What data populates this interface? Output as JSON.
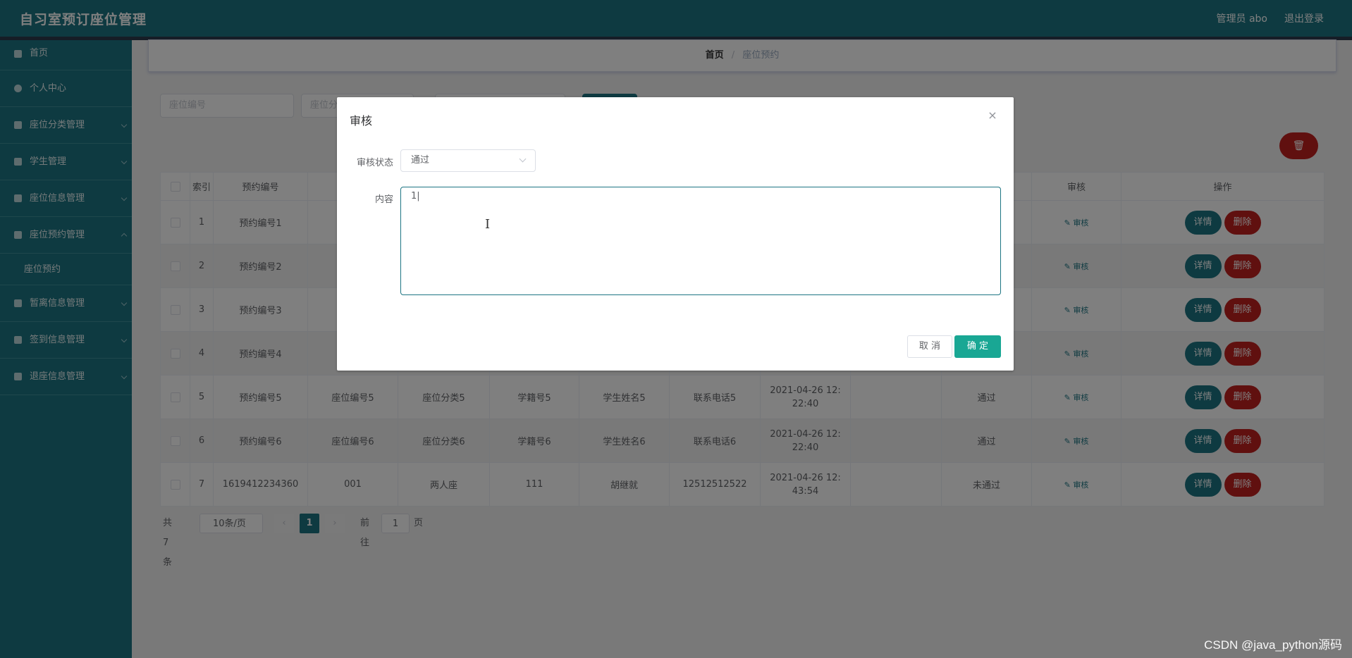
{
  "header": {
    "app_title": "自习室预订座位管理",
    "user": "管理员 abo",
    "logout": "退出登录"
  },
  "sidebar": {
    "items": [
      {
        "label": "首页",
        "icon": "home-icon"
      },
      {
        "label": "个人中心",
        "icon": "user-icon"
      },
      {
        "label": "座位分类管理",
        "icon": "list-icon"
      },
      {
        "label": "学生管理",
        "icon": "list-icon"
      },
      {
        "label": "座位信息管理",
        "icon": "list-icon"
      },
      {
        "label": "座位预约管理",
        "icon": "list-icon"
      },
      {
        "label": "座位预约",
        "icon": "",
        "sub": true
      },
      {
        "label": "暂离信息管理",
        "icon": "chart-icon"
      },
      {
        "label": "签到信息管理",
        "icon": "list-icon"
      },
      {
        "label": "退座信息管理",
        "icon": "list-icon"
      }
    ]
  },
  "breadcrumb": {
    "home": "首页",
    "sep": "/",
    "current": "座位预约"
  },
  "search": {
    "seat_no_placeholder": "座位编号",
    "seat_cat_placeholder": "座位分"
  },
  "table": {
    "headers": [
      "",
      "索引",
      "预约编号",
      "",
      "",
      "",
      "",
      "",
      "",
      "",
      "",
      "审核",
      "操作"
    ],
    "review_link": "审核",
    "detail_btn": "详情",
    "delete_btn": "删除",
    "rows": [
      {
        "idx": "1",
        "no": "预约编号1",
        "seat": "",
        "cat": "",
        "stu_no": "",
        "name": "",
        "phone": "",
        "time": "",
        "blank": "",
        "status": ""
      },
      {
        "idx": "2",
        "no": "预约编号2",
        "seat": "",
        "cat": "",
        "stu_no": "",
        "name": "",
        "phone": "",
        "time": "",
        "blank": "",
        "status": ""
      },
      {
        "idx": "3",
        "no": "预约编号3",
        "seat": "",
        "cat": "",
        "stu_no": "",
        "name": "",
        "phone": "",
        "time": "",
        "blank": "",
        "status": ""
      },
      {
        "idx": "4",
        "no": "预约编号4",
        "seat": "",
        "cat": "",
        "stu_no": "",
        "name": "",
        "phone": "",
        "time": "",
        "blank": "",
        "status": ""
      },
      {
        "idx": "5",
        "no": "预约编号5",
        "seat": "座位编号5",
        "cat": "座位分类5",
        "stu_no": "学籍号5",
        "name": "学生姓名5",
        "phone": "联系电话5",
        "time": "2021-04-26 12:22:40",
        "blank": "",
        "status": "通过"
      },
      {
        "idx": "6",
        "no": "预约编号6",
        "seat": "座位编号6",
        "cat": "座位分类6",
        "stu_no": "学籍号6",
        "name": "学生姓名6",
        "phone": "联系电话6",
        "time": "2021-04-26 12:22:40",
        "blank": "",
        "status": "通过"
      },
      {
        "idx": "7",
        "no": "1619412234360",
        "seat": "001",
        "cat": "两人座",
        "stu_no": "111",
        "name": "胡继就",
        "phone": "12512512522",
        "time": "2021-04-26 12:43:54",
        "blank": "",
        "status": "未通过"
      }
    ]
  },
  "pager": {
    "total": "共 7 条",
    "page_size": "10条/页",
    "current": "1",
    "goto_label": "前往",
    "goto_value": "1",
    "page_unit": "页"
  },
  "dialog": {
    "title": "审核",
    "status_label": "审核状态",
    "status_value": "通过",
    "content_label": "内容",
    "content_value": "1|",
    "cancel": "取 消",
    "ok": "确 定"
  },
  "watermark": "CSDN @java_python源码"
}
